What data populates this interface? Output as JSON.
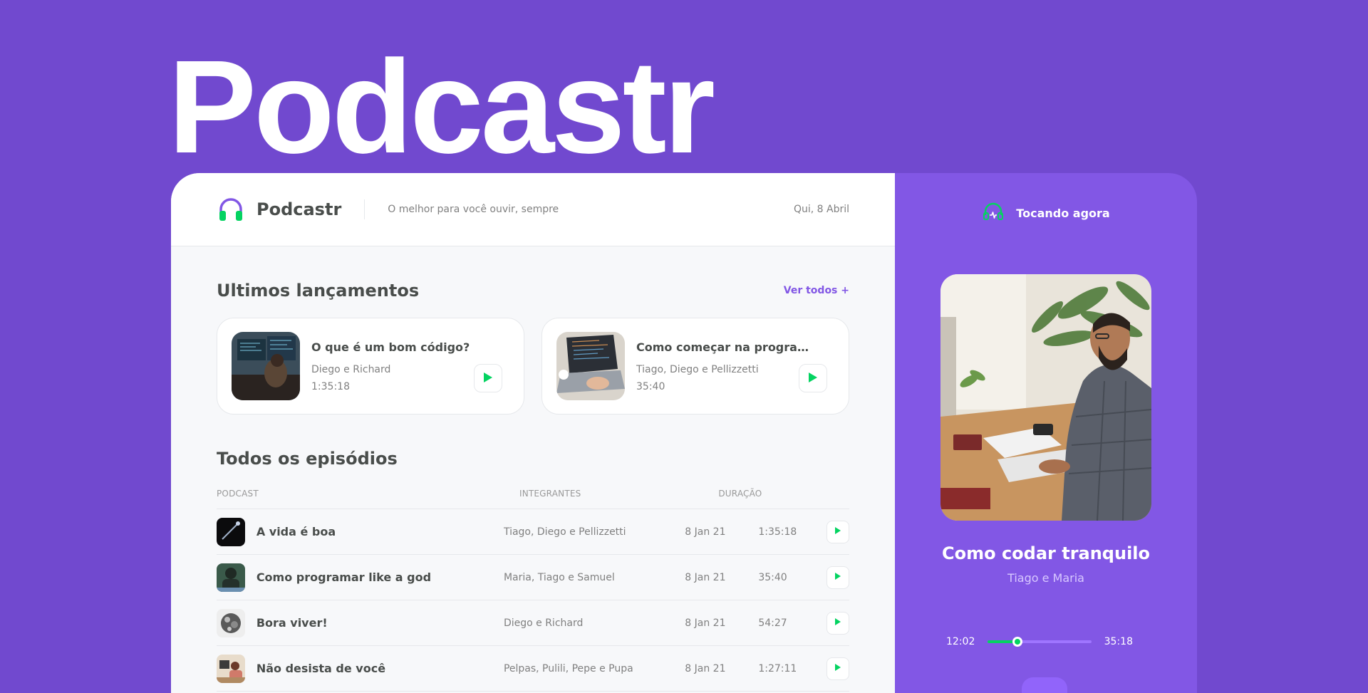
{
  "hero": {
    "title": "Podcastr"
  },
  "header": {
    "brand": "Podcastr",
    "tagline": "O melhor para você ouvir, sempre",
    "date": "Qui, 8 Abril"
  },
  "latest": {
    "title": "Ultimos lançamentos",
    "see_all": "Ver todos +",
    "episodes": [
      {
        "title": "O que é um bom código?",
        "members": "Diego e Richard",
        "duration": "1:35:18"
      },
      {
        "title": "Como começar na programaçã...",
        "members": "Tiago, Diego e Pellizzetti",
        "duration": "35:40"
      }
    ]
  },
  "all": {
    "title": "Todos os episódios",
    "columns": {
      "podcast": "PODCAST",
      "members": "INTEGRANTES",
      "duration": "DURAÇÃO"
    },
    "rows": [
      {
        "title": "A vida é boa",
        "members": "Tiago, Diego e Pellizzetti",
        "date": "8 Jan 21",
        "duration": "1:35:18"
      },
      {
        "title": "Como programar like a god",
        "members": "Maria, Tiago e Samuel",
        "date": "8 Jan 21",
        "duration": "35:40"
      },
      {
        "title": "Bora viver!",
        "members": "Diego e Richard",
        "date": "8 Jan 21",
        "duration": "54:27"
      },
      {
        "title": "Não desista de você",
        "members": "Pelpas, Pulili, Pepe e Pupa",
        "date": "8 Jan 21",
        "duration": "1:27:11"
      }
    ]
  },
  "player": {
    "label": "Tocando agora",
    "title": "Como codar tranquilo",
    "members": "Tiago e Maria",
    "current_time": "12:02",
    "total_time": "35:18",
    "progress_fraction": 0.29
  },
  "colors": {
    "background": "#7149cf",
    "accent": "#8257e5",
    "play_green": "#04d361"
  },
  "icons": {
    "brand": "headphones-icon",
    "now_playing": "headphones-pulse-icon",
    "play": "play-icon"
  }
}
